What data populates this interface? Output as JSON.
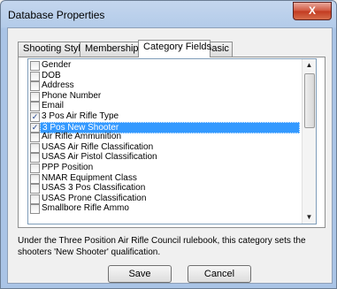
{
  "window": {
    "title": "Database Properties",
    "close_glyph": "X"
  },
  "tabs": [
    {
      "label": "Shooting Styles"
    },
    {
      "label": "Memberships"
    },
    {
      "label": "Category Fields"
    },
    {
      "label": "Basic"
    }
  ],
  "active_tab": "Category Fields",
  "fields": [
    {
      "label": "Gender",
      "checked": false
    },
    {
      "label": "DOB",
      "checked": false
    },
    {
      "label": "Address",
      "checked": false
    },
    {
      "label": "Phone Number",
      "checked": false
    },
    {
      "label": "Email",
      "checked": false
    },
    {
      "label": "3 Pos Air Rifle Type",
      "checked": true
    },
    {
      "label": "3 Pos New Shooter",
      "checked": true,
      "selected": true
    },
    {
      "label": "Air Rifle Ammunition",
      "checked": false
    },
    {
      "label": "USAS Air Rifle Classification",
      "checked": false
    },
    {
      "label": "USAS Air Pistol Classification",
      "checked": false
    },
    {
      "label": "PPP Position",
      "checked": false
    },
    {
      "label": "NMAR Equipment Class",
      "checked": false
    },
    {
      "label": "USAS 3 Pos Classification",
      "checked": false
    },
    {
      "label": "USAS Prone Classification",
      "checked": false
    },
    {
      "label": "Smallbore Rifle Ammo",
      "checked": false
    }
  ],
  "description": "Under the Three Position Air Rifle Council rulebook, this category sets the shooters 'New Shooter' qualification.",
  "buttons": {
    "save": "Save",
    "cancel": "Cancel"
  }
}
